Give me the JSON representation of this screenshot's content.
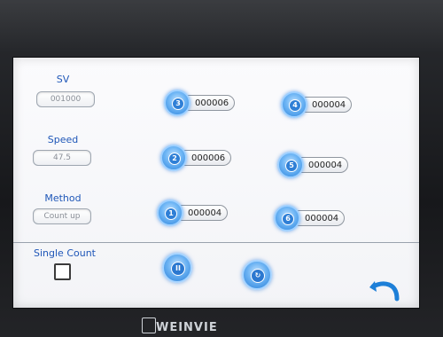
{
  "left_panel": {
    "sv_label": "SV",
    "sv_value": "001000",
    "speed_label": "Speed",
    "speed_value": "47.5",
    "method_label": "Method",
    "method_value": "Count up",
    "single_count_label": "Single Count"
  },
  "counters": [
    {
      "id": "3",
      "value": "000006"
    },
    {
      "id": "4",
      "value": "000004"
    },
    {
      "id": "2",
      "value": "000006"
    },
    {
      "id": "5",
      "value": "000004"
    },
    {
      "id": "1",
      "value": "000004"
    },
    {
      "id": "6",
      "value": "000004"
    }
  ],
  "controls": {
    "pause_symbol": "II",
    "reset_symbol": "↻"
  },
  "footer": {
    "brand": "WEINVIE"
  },
  "colors": {
    "label_blue": "#1f57b8",
    "button_blue": "#2f86de",
    "back_arrow": "#1d7fd8"
  }
}
